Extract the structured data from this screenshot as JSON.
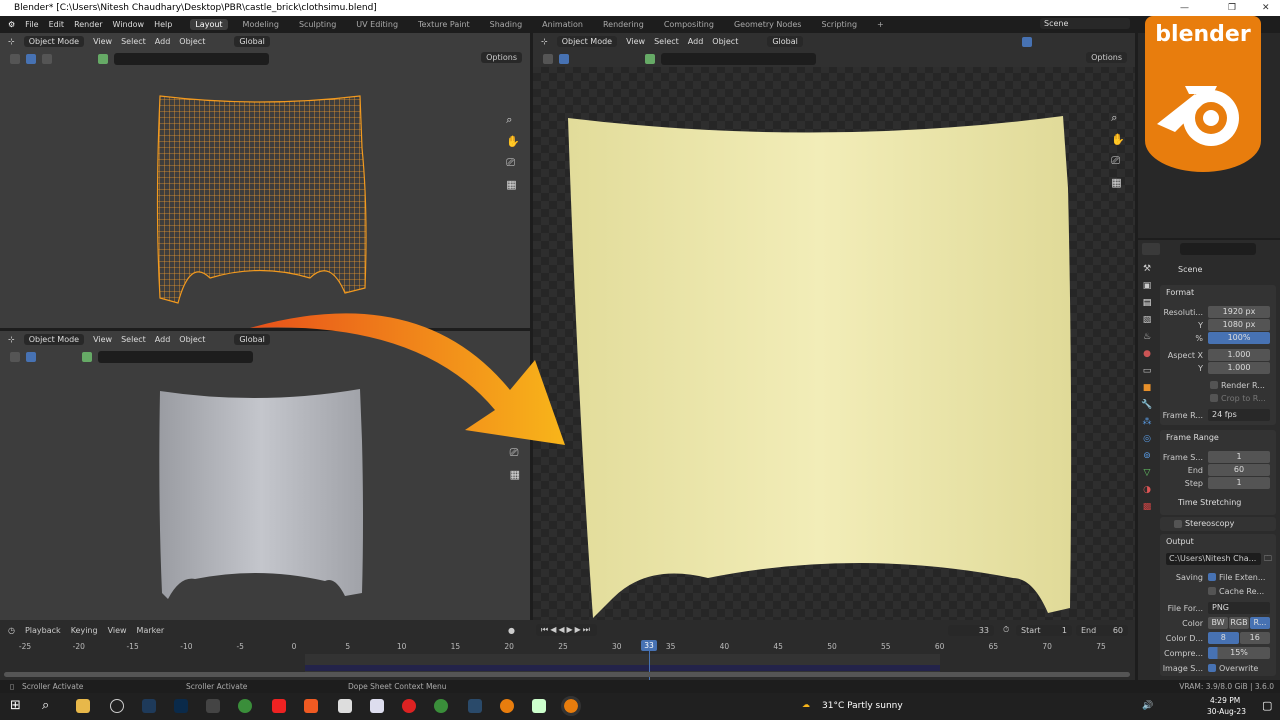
{
  "window": {
    "title": "Blender* [C:\\Users\\Nitesh Chaudhary\\Desktop\\PBR\\castle_brick\\clothsimu.blend]",
    "minimize": "—",
    "maximize": "❐",
    "close": "✕"
  },
  "menu": [
    "File",
    "Edit",
    "Render",
    "Window",
    "Help"
  ],
  "workspaces": [
    "Layout",
    "Modeling",
    "Sculpting",
    "UV Editing",
    "Texture Paint",
    "Shading",
    "Animation",
    "Rendering",
    "Compositing",
    "Geometry Nodes",
    "Scripting",
    "+"
  ],
  "scene": "Scene",
  "viewport_header": {
    "mode": "Object Mode",
    "view": "View",
    "select": "Select",
    "add": "Add",
    "object": "Object",
    "orientation": "Global",
    "options": "Options"
  },
  "logo": {
    "text": "blender",
    "color": "#e87d0d"
  },
  "properties": {
    "scene_label": "Scene",
    "format": {
      "title": "Format",
      "res_x_label": "Resoluti...",
      "res_x": "1920 px",
      "res_y_label": "Y",
      "res_y": "1080 px",
      "pct_label": "%",
      "pct": "100%",
      "aspect_x_label": "Aspect X",
      "aspect_x": "1.000",
      "aspect_y_label": "Y",
      "aspect_y": "1.000",
      "render_region": "Render R...",
      "crop": "Crop to R...",
      "frame_rate_label": "Frame R...",
      "frame_rate": "24 fps"
    },
    "frame_range": {
      "title": "Frame Range",
      "start_label": "Frame S...",
      "start": "1",
      "end_label": "End",
      "end": "60",
      "step_label": "Step",
      "step": "1",
      "time_stretching": "Time Stretching"
    },
    "stereoscopy": "Stereoscopy",
    "output": {
      "title": "Output",
      "path": "C:\\Users\\Nitesh Cha...",
      "saving_label": "Saving",
      "file_ext": "File Exten...",
      "cache": "Cache Re...",
      "format_label": "File For...",
      "format": "PNG",
      "color_label": "Color",
      "color_opts": [
        "BW",
        "RGB",
        "R..."
      ],
      "depth_label": "Color D...",
      "depth_opts": [
        "8",
        "16"
      ],
      "compress_label": "Compre...",
      "compress": "15%",
      "compress_value": 15,
      "image_seq_label": "Image S...",
      "overwrite": "Overwrite"
    }
  },
  "timeline": {
    "menus": [
      "Playback",
      "Keying",
      "View",
      "Marker"
    ],
    "current_frame": "33",
    "start_label": "Start",
    "start": "1",
    "end_label": "End",
    "end": "60",
    "ticks": [
      "-25",
      "-20",
      "-15",
      "-10",
      "-5",
      "0",
      "5",
      "10",
      "15",
      "20",
      "25",
      "30",
      "35",
      "40",
      "45",
      "50",
      "55",
      "60",
      "65",
      "70",
      "75"
    ]
  },
  "status": {
    "left1": "Scroller Activate",
    "left2": "Scroller Activate",
    "ctx": "Dope Sheet Context Menu",
    "vram": "VRAM: 3.9/8.0 GiB | 3.6.0"
  },
  "taskbar": {
    "weather": "31°C  Partly sunny",
    "time": "4:29 PM",
    "date": "30-Aug-23"
  }
}
